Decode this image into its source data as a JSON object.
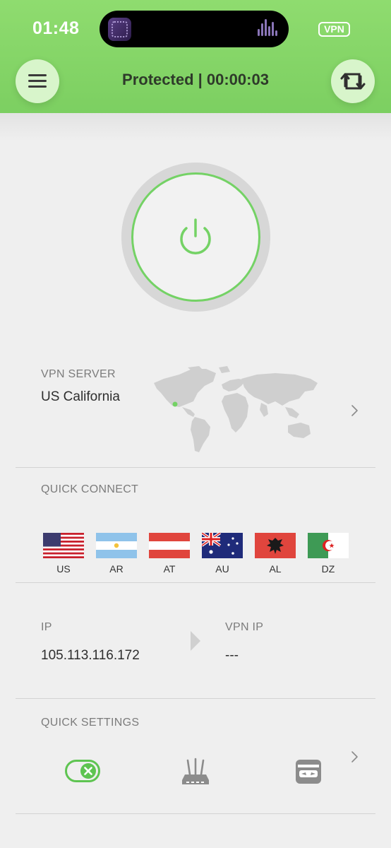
{
  "status_bar": {
    "time": "01:48",
    "vpn_badge": "VPN"
  },
  "header": {
    "title": "Protected | 00:00:03"
  },
  "power": {
    "state": "connected",
    "color": "#74d265"
  },
  "vpn_server": {
    "label": "VPN SERVER",
    "value": "US California"
  },
  "quick_connect": {
    "label": "QUICK CONNECT",
    "countries": [
      {
        "code": "US",
        "flag": "us-flag"
      },
      {
        "code": "AR",
        "flag": "ar-flag"
      },
      {
        "code": "AT",
        "flag": "at-flag"
      },
      {
        "code": "AU",
        "flag": "au-flag"
      },
      {
        "code": "AL",
        "flag": "al-flag"
      },
      {
        "code": "DZ",
        "flag": "dz-flag"
      }
    ]
  },
  "ip": {
    "label": "IP",
    "value": "105.113.116.172"
  },
  "vpn_ip": {
    "label": "VPN IP",
    "value": "---"
  },
  "quick_settings": {
    "label": "QUICK SETTINGS",
    "icons": [
      "kill-switch-toggle-icon",
      "router-icon",
      "incognito-icon"
    ]
  },
  "colors": {
    "accent": "#7ccf61",
    "header_button_bg": "#d8f5cb",
    "background": "#efefef"
  }
}
